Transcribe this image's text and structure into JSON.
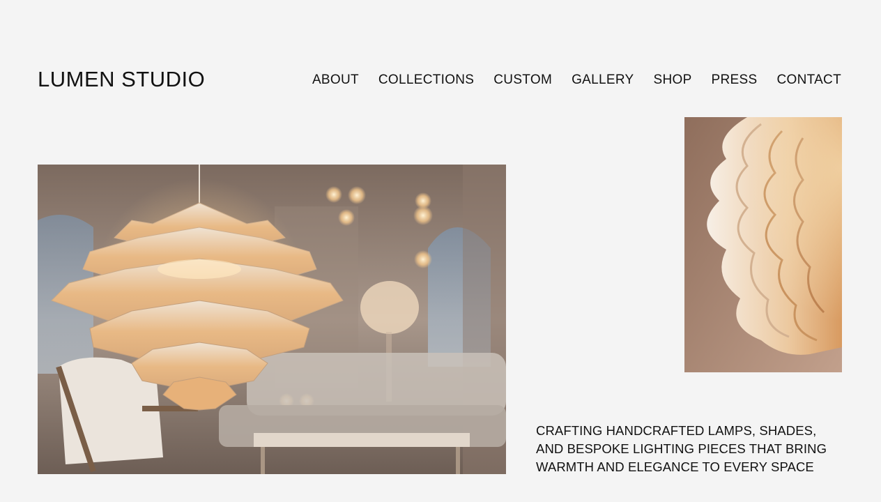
{
  "brand": {
    "name": "LUMEN STUDIO"
  },
  "nav": {
    "items": [
      {
        "label": "ABOUT"
      },
      {
        "label": "COLLECTIONS"
      },
      {
        "label": "CUSTOM"
      },
      {
        "label": "GALLERY"
      },
      {
        "label": "SHOP"
      },
      {
        "label": "PRESS"
      },
      {
        "label": "CONTACT"
      }
    ]
  },
  "tagline": {
    "line1": "CRAFTING HANDCRAFTED LAMPS, SHADES,",
    "line2": "AND BESPOKE LIGHTING PIECES THAT BRING",
    "line3": "WARMTH AND ELEGANCE TO EVERY SPACE"
  },
  "colors": {
    "background": "#f4f4f4",
    "text": "#111111",
    "warm_glow": "#f2b46a"
  }
}
